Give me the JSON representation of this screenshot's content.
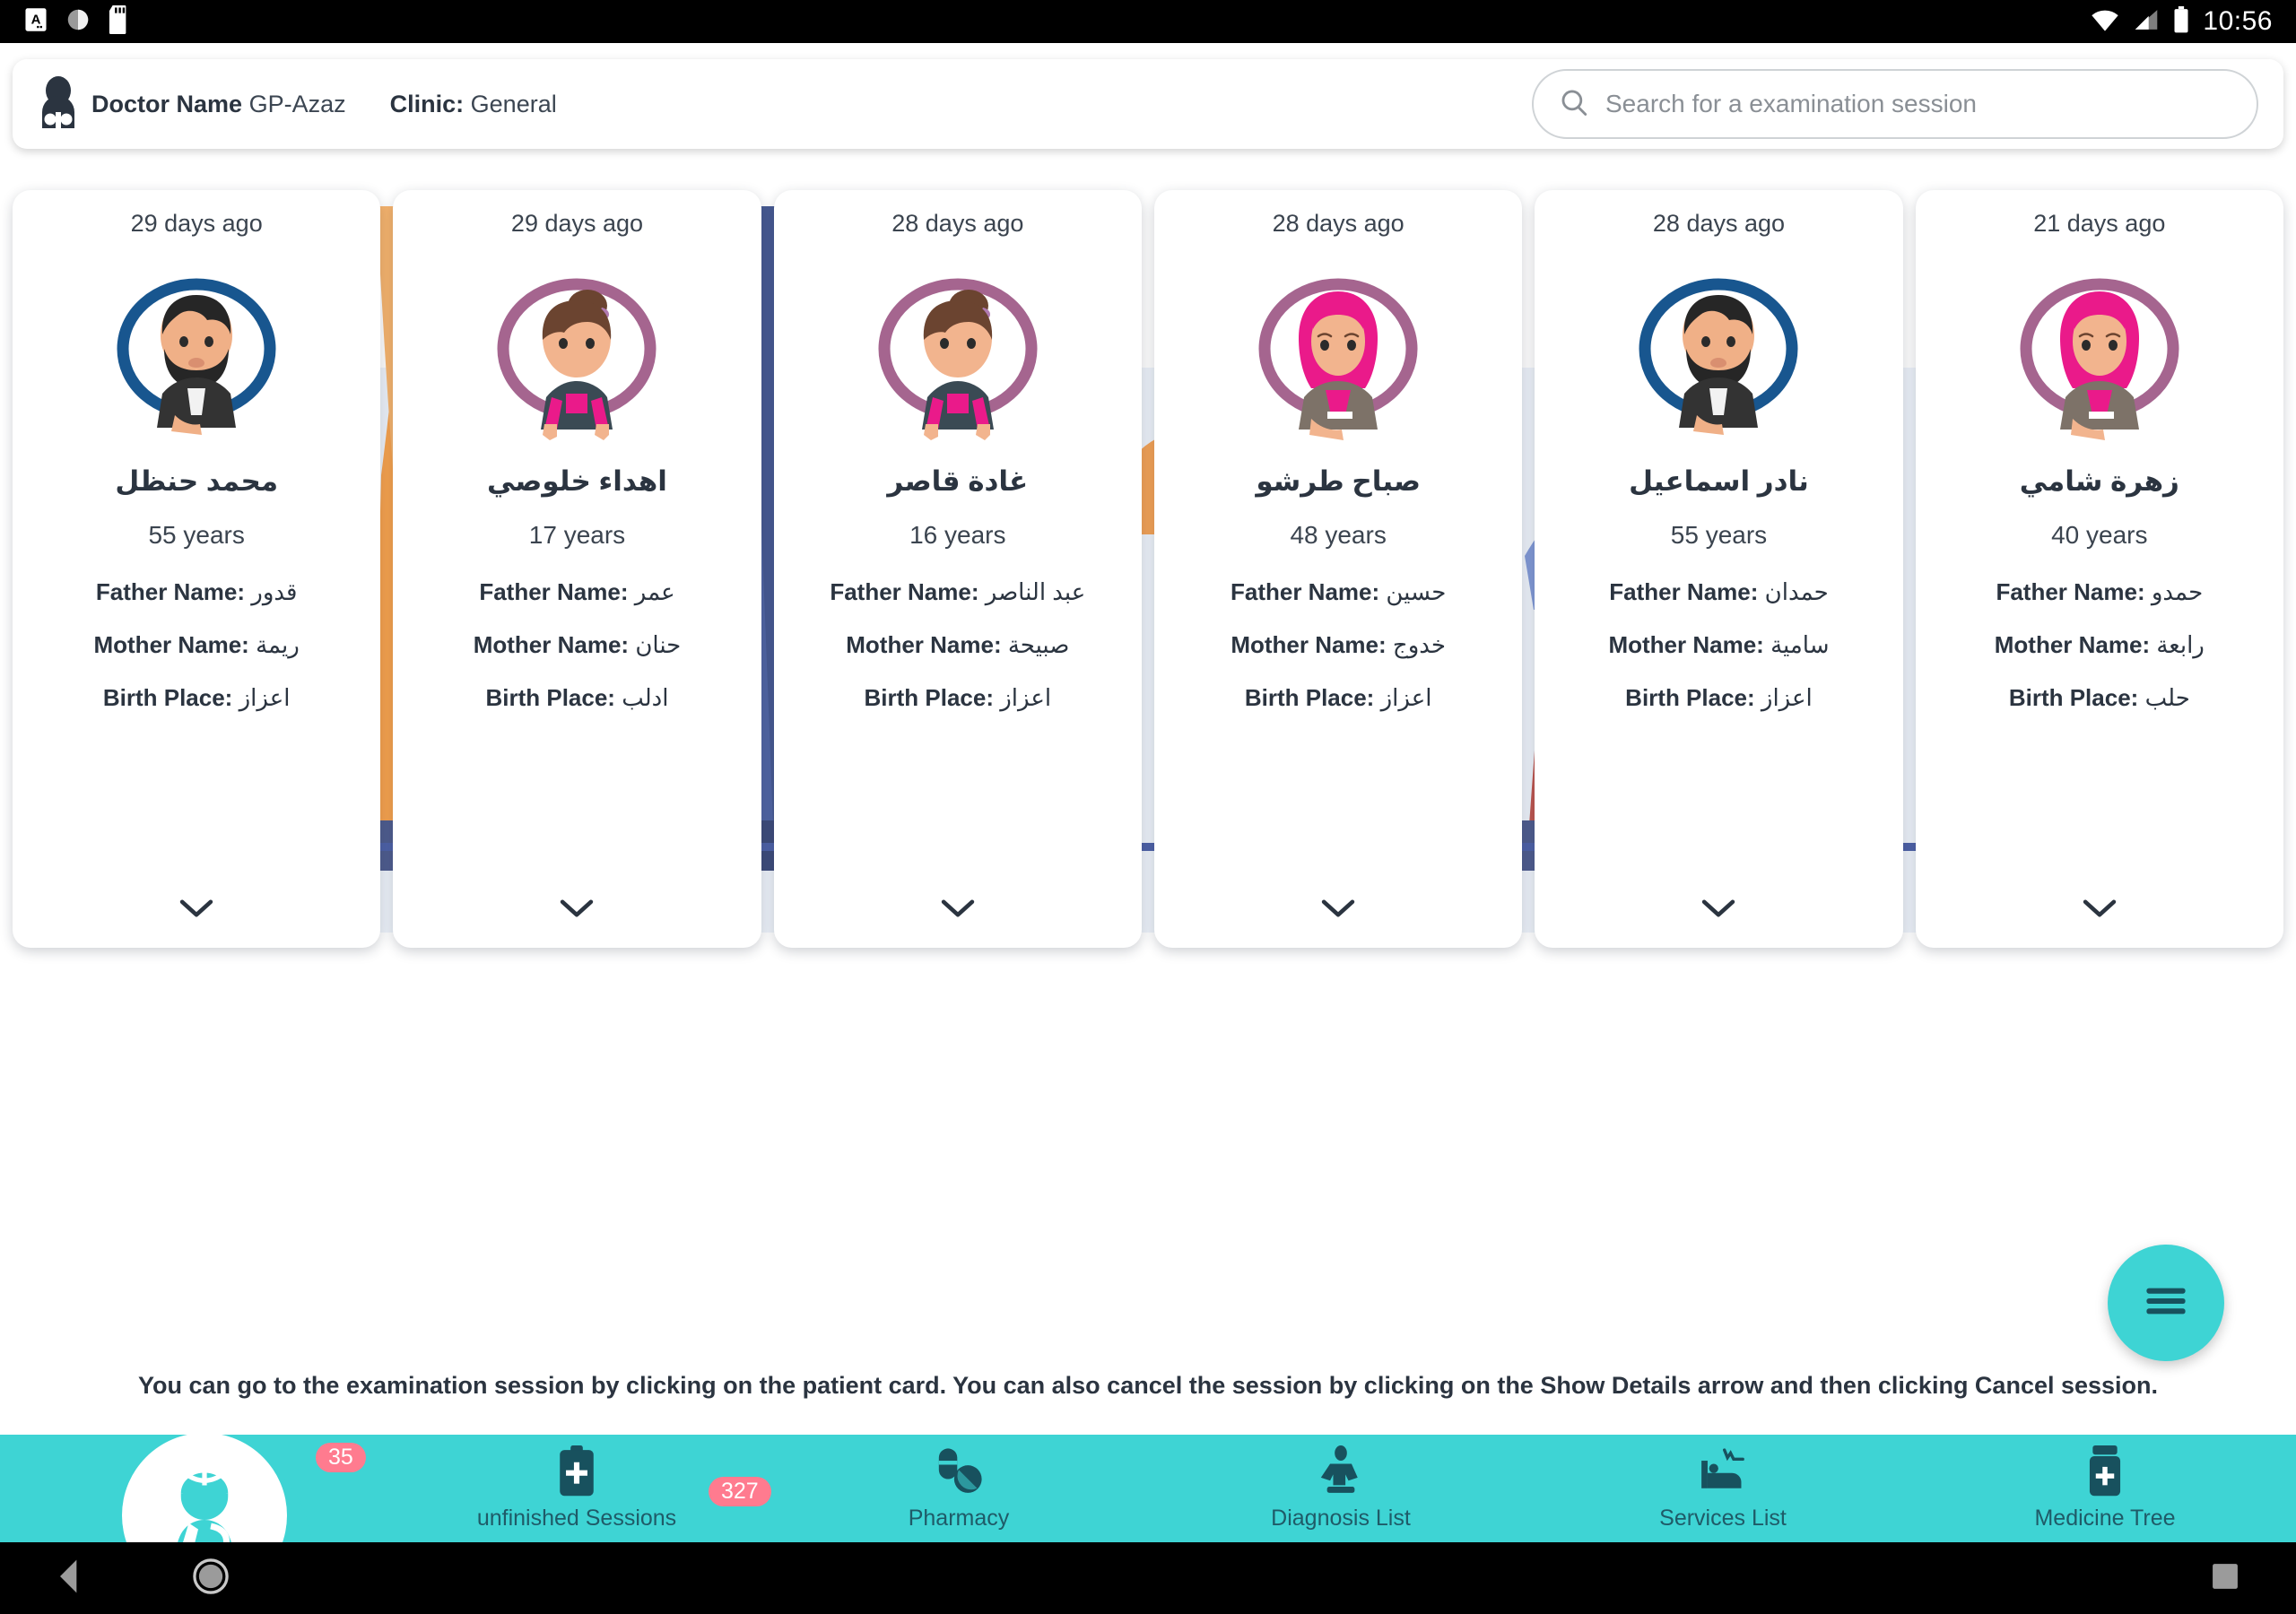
{
  "statusbar": {
    "clock": "10:56",
    "icons_left": [
      "text-input-icon",
      "sync-icon",
      "sd-card-icon"
    ],
    "icons_right": [
      "wifi-icon",
      "signal-icon",
      "battery-icon"
    ]
  },
  "header": {
    "doctor_label": "Doctor Name",
    "doctor_value": "GP-Azaz",
    "clinic_label": "Clinic:",
    "clinic_value": "General",
    "doctor_icon": "doctor-stethoscope-icon"
  },
  "search": {
    "placeholder": "Search for a examination session",
    "icon": "search-icon",
    "value": ""
  },
  "labels": {
    "father": "Father Name:",
    "mother": "Mother Name:",
    "birth": "Birth Place:",
    "expand_icon": "chevron-down-icon"
  },
  "cards": [
    {
      "ago": "29 days ago",
      "name": "محمد حنظل",
      "age": "55 years",
      "father": "قدور",
      "mother": "ريمة",
      "birth_place": "اعزاز",
      "avatar": "male-bearded-avatar",
      "ring_color": "#18568f"
    },
    {
      "ago": "29 days ago",
      "name": "اهداء خلوصي",
      "age": "17 years",
      "father": "عمر",
      "mother": "حنان",
      "birth_place": "ادلب",
      "avatar": "girl-bun-avatar",
      "ring_color": "#a5658f"
    },
    {
      "ago": "28 days ago",
      "name": "غادة قاصر",
      "age": "16 years",
      "father": "عبد الناصر",
      "mother": "صبيحة",
      "birth_place": "اعزاز",
      "avatar": "girl-bun-avatar",
      "ring_color": "#a5658f"
    },
    {
      "ago": "28 days ago",
      "name": "صباح طرشو",
      "age": "48 years",
      "father": "حسين",
      "mother": "خدوج",
      "birth_place": "اعزاز",
      "avatar": "female-hijab-avatar",
      "ring_color": "#a5658f"
    },
    {
      "ago": "28 days ago",
      "name": "نادر اسماعيل",
      "age": "55 years",
      "father": "حمدان",
      "mother": "سامية",
      "birth_place": "اعزاز",
      "avatar": "male-bearded-avatar",
      "ring_color": "#18568f"
    },
    {
      "ago": "21 days ago",
      "name": "زهرة شامي",
      "age": "40 years",
      "father": "حمدو",
      "mother": "رابعة",
      "birth_place": "حلب",
      "avatar": "female-hijab-avatar",
      "ring_color": "#a5658f"
    }
  ],
  "tip": {
    "text": "You can go to the examination session by clicking on the patient card. You can also cancel the session by clicking on the Show Details arrow and then clicking Cancel session."
  },
  "bottomnav": {
    "home_icon": "injured-patient-icon",
    "home_badge": "35",
    "items": [
      {
        "label": "unfinished Sessions",
        "icon": "clipboard-medical-icon",
        "badge": "327"
      },
      {
        "label": "Pharmacy",
        "icon": "pills-icon",
        "badge": ""
      },
      {
        "label": "Diagnosis List",
        "icon": "patient-diagnosis-icon",
        "badge": ""
      },
      {
        "label": "Services List",
        "icon": "hospital-bed-icon",
        "badge": ""
      },
      {
        "label": "Medicine Tree",
        "icon": "medicine-bottle-icon",
        "badge": ""
      }
    ]
  },
  "fab": {
    "icon": "hamburger-menu-icon",
    "label": ""
  },
  "android_nav": {
    "back": "back-triangle-icon",
    "home": "home-circle-icon",
    "recent": "recent-apps-icon"
  },
  "colors": {
    "teal": "#3ed4d4",
    "badge_pink": "#ff7b8f",
    "dark_text": "#2b3440",
    "ring_blue": "#18568f",
    "ring_purple": "#a5658f"
  }
}
